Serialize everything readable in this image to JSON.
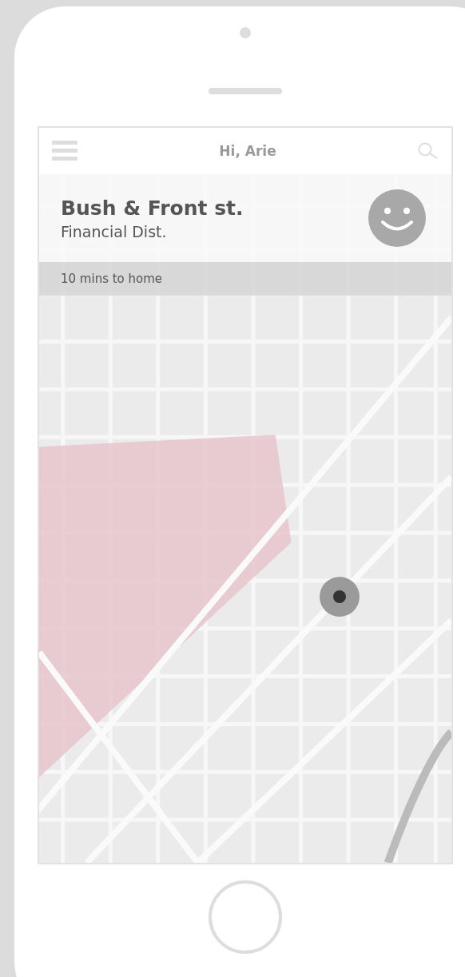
{
  "header": {
    "greeting": "Hi, Arie"
  },
  "location": {
    "street": "Bush & Front st.",
    "district": "Financial Dist."
  },
  "eta": "10 mins to home"
}
